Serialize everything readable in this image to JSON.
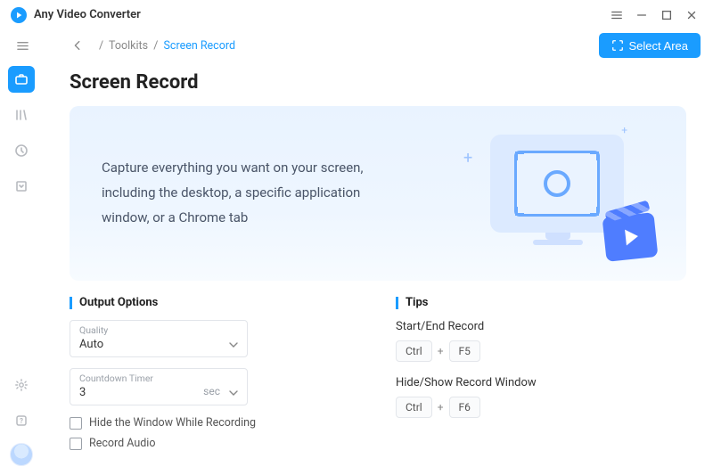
{
  "app": {
    "title": "Any Video Converter"
  },
  "breadcrumb": {
    "root": "Toolkits",
    "current": "Screen Record"
  },
  "toolbar": {
    "select_area": "Select Area"
  },
  "page": {
    "title": "Screen Record",
    "hero_text": "Capture everything you want on your screen, including the desktop, a specific application window, or a Chrome tab"
  },
  "output": {
    "section_title": "Output Options",
    "quality_label": "Quality",
    "quality_value": "Auto",
    "countdown_label": "Countdown Timer",
    "countdown_value": "3",
    "countdown_unit": "sec",
    "hide_window_label": "Hide the Window While Recording",
    "record_audio_label": "Record Audio"
  },
  "tips": {
    "section_title": "Tips",
    "start_end_label": "Start/End Record",
    "start_end_keys": [
      "Ctrl",
      "F5"
    ],
    "hide_show_label": "Hide/Show Record Window",
    "hide_show_keys": [
      "Ctrl",
      "F6"
    ]
  }
}
